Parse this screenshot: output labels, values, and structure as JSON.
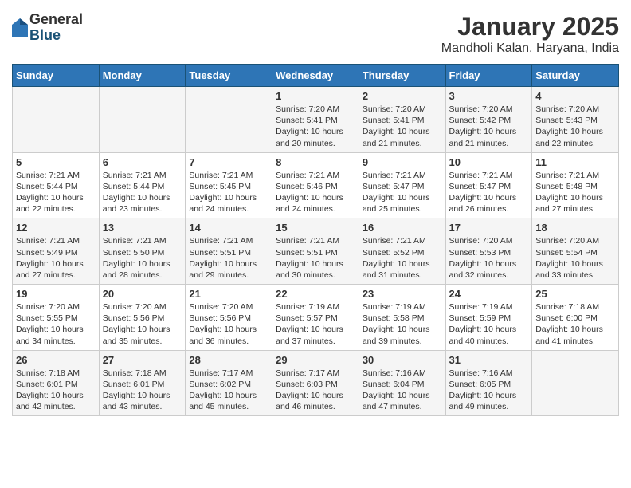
{
  "logo": {
    "general": "General",
    "blue": "Blue"
  },
  "title": "January 2025",
  "subtitle": "Mandholi Kalan, Haryana, India",
  "weekdays": [
    "Sunday",
    "Monday",
    "Tuesday",
    "Wednesday",
    "Thursday",
    "Friday",
    "Saturday"
  ],
  "weeks": [
    [
      {
        "day": "",
        "sunrise": "",
        "sunset": "",
        "daylight": ""
      },
      {
        "day": "",
        "sunrise": "",
        "sunset": "",
        "daylight": ""
      },
      {
        "day": "",
        "sunrise": "",
        "sunset": "",
        "daylight": ""
      },
      {
        "day": "1",
        "sunrise": "Sunrise: 7:20 AM",
        "sunset": "Sunset: 5:41 PM",
        "daylight": "Daylight: 10 hours and 20 minutes."
      },
      {
        "day": "2",
        "sunrise": "Sunrise: 7:20 AM",
        "sunset": "Sunset: 5:41 PM",
        "daylight": "Daylight: 10 hours and 21 minutes."
      },
      {
        "day": "3",
        "sunrise": "Sunrise: 7:20 AM",
        "sunset": "Sunset: 5:42 PM",
        "daylight": "Daylight: 10 hours and 21 minutes."
      },
      {
        "day": "4",
        "sunrise": "Sunrise: 7:20 AM",
        "sunset": "Sunset: 5:43 PM",
        "daylight": "Daylight: 10 hours and 22 minutes."
      }
    ],
    [
      {
        "day": "5",
        "sunrise": "Sunrise: 7:21 AM",
        "sunset": "Sunset: 5:44 PM",
        "daylight": "Daylight: 10 hours and 22 minutes."
      },
      {
        "day": "6",
        "sunrise": "Sunrise: 7:21 AM",
        "sunset": "Sunset: 5:44 PM",
        "daylight": "Daylight: 10 hours and 23 minutes."
      },
      {
        "day": "7",
        "sunrise": "Sunrise: 7:21 AM",
        "sunset": "Sunset: 5:45 PM",
        "daylight": "Daylight: 10 hours and 24 minutes."
      },
      {
        "day": "8",
        "sunrise": "Sunrise: 7:21 AM",
        "sunset": "Sunset: 5:46 PM",
        "daylight": "Daylight: 10 hours and 24 minutes."
      },
      {
        "day": "9",
        "sunrise": "Sunrise: 7:21 AM",
        "sunset": "Sunset: 5:47 PM",
        "daylight": "Daylight: 10 hours and 25 minutes."
      },
      {
        "day": "10",
        "sunrise": "Sunrise: 7:21 AM",
        "sunset": "Sunset: 5:47 PM",
        "daylight": "Daylight: 10 hours and 26 minutes."
      },
      {
        "day": "11",
        "sunrise": "Sunrise: 7:21 AM",
        "sunset": "Sunset: 5:48 PM",
        "daylight": "Daylight: 10 hours and 27 minutes."
      }
    ],
    [
      {
        "day": "12",
        "sunrise": "Sunrise: 7:21 AM",
        "sunset": "Sunset: 5:49 PM",
        "daylight": "Daylight: 10 hours and 27 minutes."
      },
      {
        "day": "13",
        "sunrise": "Sunrise: 7:21 AM",
        "sunset": "Sunset: 5:50 PM",
        "daylight": "Daylight: 10 hours and 28 minutes."
      },
      {
        "day": "14",
        "sunrise": "Sunrise: 7:21 AM",
        "sunset": "Sunset: 5:51 PM",
        "daylight": "Daylight: 10 hours and 29 minutes."
      },
      {
        "day": "15",
        "sunrise": "Sunrise: 7:21 AM",
        "sunset": "Sunset: 5:51 PM",
        "daylight": "Daylight: 10 hours and 30 minutes."
      },
      {
        "day": "16",
        "sunrise": "Sunrise: 7:21 AM",
        "sunset": "Sunset: 5:52 PM",
        "daylight": "Daylight: 10 hours and 31 minutes."
      },
      {
        "day": "17",
        "sunrise": "Sunrise: 7:20 AM",
        "sunset": "Sunset: 5:53 PM",
        "daylight": "Daylight: 10 hours and 32 minutes."
      },
      {
        "day": "18",
        "sunrise": "Sunrise: 7:20 AM",
        "sunset": "Sunset: 5:54 PM",
        "daylight": "Daylight: 10 hours and 33 minutes."
      }
    ],
    [
      {
        "day": "19",
        "sunrise": "Sunrise: 7:20 AM",
        "sunset": "Sunset: 5:55 PM",
        "daylight": "Daylight: 10 hours and 34 minutes."
      },
      {
        "day": "20",
        "sunrise": "Sunrise: 7:20 AM",
        "sunset": "Sunset: 5:56 PM",
        "daylight": "Daylight: 10 hours and 35 minutes."
      },
      {
        "day": "21",
        "sunrise": "Sunrise: 7:20 AM",
        "sunset": "Sunset: 5:56 PM",
        "daylight": "Daylight: 10 hours and 36 minutes."
      },
      {
        "day": "22",
        "sunrise": "Sunrise: 7:19 AM",
        "sunset": "Sunset: 5:57 PM",
        "daylight": "Daylight: 10 hours and 37 minutes."
      },
      {
        "day": "23",
        "sunrise": "Sunrise: 7:19 AM",
        "sunset": "Sunset: 5:58 PM",
        "daylight": "Daylight: 10 hours and 39 minutes."
      },
      {
        "day": "24",
        "sunrise": "Sunrise: 7:19 AM",
        "sunset": "Sunset: 5:59 PM",
        "daylight": "Daylight: 10 hours and 40 minutes."
      },
      {
        "day": "25",
        "sunrise": "Sunrise: 7:18 AM",
        "sunset": "Sunset: 6:00 PM",
        "daylight": "Daylight: 10 hours and 41 minutes."
      }
    ],
    [
      {
        "day": "26",
        "sunrise": "Sunrise: 7:18 AM",
        "sunset": "Sunset: 6:01 PM",
        "daylight": "Daylight: 10 hours and 42 minutes."
      },
      {
        "day": "27",
        "sunrise": "Sunrise: 7:18 AM",
        "sunset": "Sunset: 6:01 PM",
        "daylight": "Daylight: 10 hours and 43 minutes."
      },
      {
        "day": "28",
        "sunrise": "Sunrise: 7:17 AM",
        "sunset": "Sunset: 6:02 PM",
        "daylight": "Daylight: 10 hours and 45 minutes."
      },
      {
        "day": "29",
        "sunrise": "Sunrise: 7:17 AM",
        "sunset": "Sunset: 6:03 PM",
        "daylight": "Daylight: 10 hours and 46 minutes."
      },
      {
        "day": "30",
        "sunrise": "Sunrise: 7:16 AM",
        "sunset": "Sunset: 6:04 PM",
        "daylight": "Daylight: 10 hours and 47 minutes."
      },
      {
        "day": "31",
        "sunrise": "Sunrise: 7:16 AM",
        "sunset": "Sunset: 6:05 PM",
        "daylight": "Daylight: 10 hours and 49 minutes."
      },
      {
        "day": "",
        "sunrise": "",
        "sunset": "",
        "daylight": ""
      }
    ]
  ]
}
